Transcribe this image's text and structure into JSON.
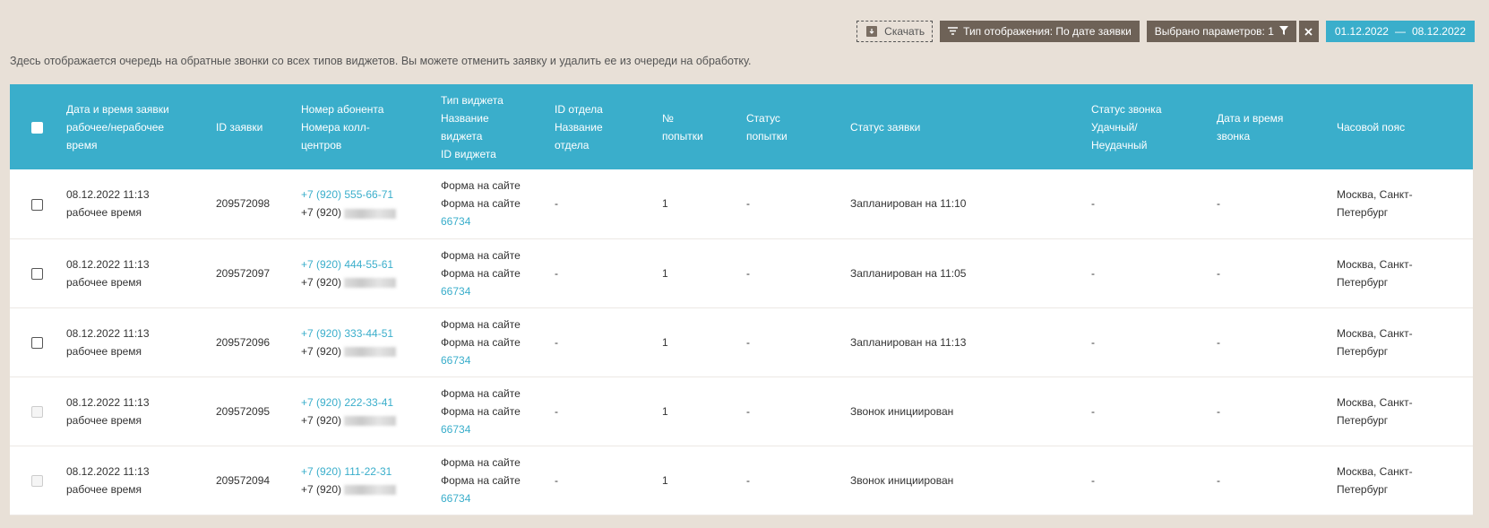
{
  "toolbar": {
    "download_label": "Скачать",
    "display_type_label": "Тип отображения: По дате заявки",
    "params_label": "Выбрано параметров: 1",
    "date_from": "01.12.2022",
    "date_separator": "—",
    "date_to": "08.12.2022",
    "accent_color": "#3aaecb"
  },
  "description": "Здесь отображается очередь на обратные звонки со всех типов виджетов. Вы можете отменить заявку и удалить ее из очереди на обработку.",
  "table": {
    "headers": {
      "date_l1": "Дата и время заявки",
      "date_l2": "рабочее/нерабочее",
      "date_l3": "время",
      "id": "ID заявки",
      "phone_l1": "Номер абонента",
      "phone_l2": "Номера колл-",
      "phone_l3": "центров",
      "widget_l1": "Тип виджета",
      "widget_l2": "Название",
      "widget_l3": "виджета",
      "widget_l4": "ID виджета",
      "dept_l1": "ID отдела",
      "dept_l2": "Название",
      "dept_l3": "отдела",
      "attempts_l1": "№",
      "attempts_l2": "попытки",
      "attempt_status_l1": "Статус",
      "attempt_status_l2": "попытки",
      "request_status": "Статус заявки",
      "call_status_l1": "Статус звонка",
      "call_status_l2": "Удачный/",
      "call_status_l3": "Неудачный",
      "call_date_l1": "Дата и время",
      "call_date_l2": "звонка",
      "timezone": "Часовой пояс"
    },
    "rows": [
      {
        "date": "08.12.2022 11:13",
        "time_type": "рабочее время",
        "id": "209572098",
        "phone": "+7 (920) 555-66-71",
        "cc_prefix": "+7 (920)",
        "widget_type": "Форма на сайте",
        "widget_name": "Форма на сайте",
        "widget_id": "66734",
        "dept": "-",
        "attempt": "1",
        "attempt_status": "-",
        "request_status": "Запланирован на 11:10",
        "call_status": "-",
        "call_date": "-",
        "tz_l1": "Москва, Санкт-",
        "tz_l2": "Петербург",
        "checkbox_enabled": true
      },
      {
        "date": "08.12.2022 11:13",
        "time_type": "рабочее время",
        "id": "209572097",
        "phone": "+7 (920) 444-55-61",
        "cc_prefix": "+7 (920)",
        "widget_type": "Форма на сайте",
        "widget_name": "Форма на сайте",
        "widget_id": "66734",
        "dept": "-",
        "attempt": "1",
        "attempt_status": "-",
        "request_status": "Запланирован на 11:05",
        "call_status": "-",
        "call_date": "-",
        "tz_l1": "Москва, Санкт-",
        "tz_l2": "Петербург",
        "checkbox_enabled": true
      },
      {
        "date": "08.12.2022 11:13",
        "time_type": "рабочее время",
        "id": "209572096",
        "phone": "+7 (920) 333-44-51",
        "cc_prefix": "+7 (920)",
        "widget_type": "Форма на сайте",
        "widget_name": "Форма на сайте",
        "widget_id": "66734",
        "dept": "-",
        "attempt": "1",
        "attempt_status": "-",
        "request_status": "Запланирован на 11:13",
        "call_status": "-",
        "call_date": "-",
        "tz_l1": "Москва, Санкт-",
        "tz_l2": "Петербург",
        "checkbox_enabled": true
      },
      {
        "date": "08.12.2022 11:13",
        "time_type": "рабочее время",
        "id": "209572095",
        "phone": "+7 (920) 222-33-41",
        "cc_prefix": "+7 (920)",
        "widget_type": "Форма на сайте",
        "widget_name": "Форма на сайте",
        "widget_id": "66734",
        "dept": "-",
        "attempt": "1",
        "attempt_status": "-",
        "request_status": "Звонок инициирован",
        "call_status": "-",
        "call_date": "-",
        "tz_l1": "Москва, Санкт-",
        "tz_l2": "Петербург",
        "checkbox_enabled": false
      },
      {
        "date": "08.12.2022 11:13",
        "time_type": "рабочее время",
        "id": "209572094",
        "phone": "+7 (920) 111-22-31",
        "cc_prefix": "+7 (920)",
        "widget_type": "Форма на сайте",
        "widget_name": "Форма на сайте",
        "widget_id": "66734",
        "dept": "-",
        "attempt": "1",
        "attempt_status": "-",
        "request_status": "Звонок инициирован",
        "call_status": "-",
        "call_date": "-",
        "tz_l1": "Москва, Санкт-",
        "tz_l2": "Петербург",
        "checkbox_enabled": false
      }
    ]
  }
}
